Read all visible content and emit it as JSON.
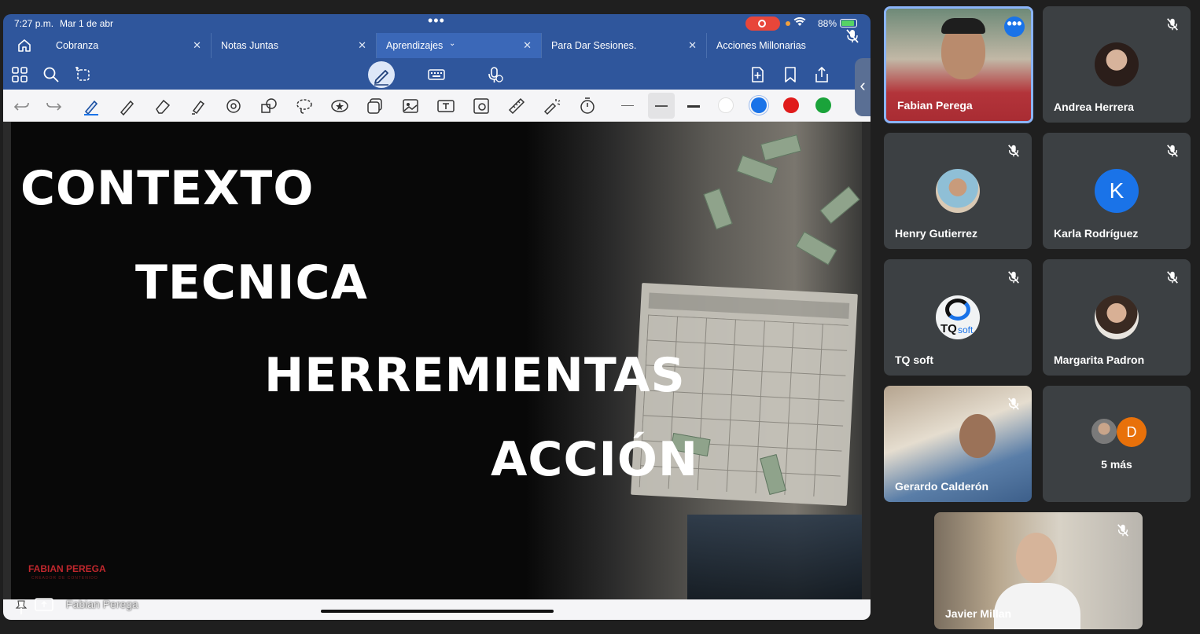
{
  "status_bar": {
    "time": "7:27 p.m.",
    "date": "Mar 1 de abr",
    "battery": "88%"
  },
  "tabs": [
    {
      "label": "Cobranza"
    },
    {
      "label": "Notas Juntas"
    },
    {
      "label": "Aprendizajes"
    },
    {
      "label": "Para Dar Sesiones."
    },
    {
      "label": "Acciones Millonarias"
    }
  ],
  "colors": {
    "accent": "#2f569c",
    "active_tab": "#3b68b8",
    "pen_blue": "#1a73e8",
    "red": "#e01b1b",
    "green": "#1aa33a",
    "tile_bg": "#3c4043"
  },
  "slide": {
    "words": [
      "CONTEXTO",
      "TECNICA",
      "HERREMIENTAS",
      "ACCIÓN"
    ],
    "brand": "FABIAN PEREGA",
    "brand_sub": "CREADOR DE CONTENIDO"
  },
  "presenter_label": "Fabian Perega",
  "participants": [
    {
      "name": "Fabian Perega",
      "type": "video",
      "active": true
    },
    {
      "name": "Andrea Herrera",
      "type": "photo"
    },
    {
      "name": "Henry Gutierrez",
      "type": "photo"
    },
    {
      "name": "Karla Rodríguez",
      "type": "initial",
      "initial": "K",
      "color": "#1a73e8"
    },
    {
      "name": "TQ soft",
      "type": "logo",
      "logo_text": "TQ",
      "logo_suffix": "soft"
    },
    {
      "name": "Margarita Padron",
      "type": "photo"
    },
    {
      "name": "Gerardo Calderón",
      "type": "video"
    },
    {
      "name": "5 más",
      "type": "overflow",
      "initial": "D",
      "color": "#e8710a"
    },
    {
      "name": "Javier Millan",
      "type": "video"
    }
  ],
  "icons": {
    "more": "more-horizontal-icon",
    "mic_off": "mic-off-icon"
  }
}
